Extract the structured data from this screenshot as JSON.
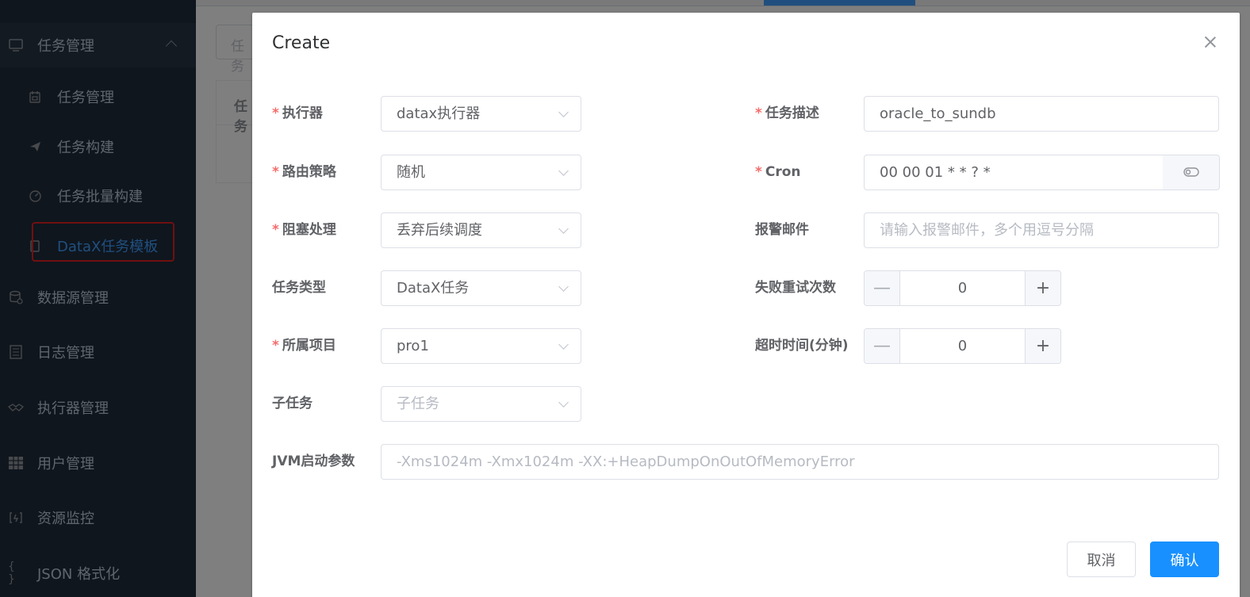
{
  "sidebar": {
    "group_label": "任务管理",
    "sub_items": [
      {
        "label": "任务管理",
        "icon": "calendar-icon"
      },
      {
        "label": "任务构建",
        "icon": "send-icon"
      },
      {
        "label": "任务批量构建",
        "icon": "dashboard-icon"
      },
      {
        "label": "DataX任务模板",
        "icon": "document-icon"
      }
    ],
    "items": [
      {
        "label": "数据源管理",
        "icon": "database-icon"
      },
      {
        "label": "日志管理",
        "icon": "log-icon"
      },
      {
        "label": "执行器管理",
        "icon": "handshake-icon"
      },
      {
        "label": "用户管理",
        "icon": "grid-icon"
      },
      {
        "label": "资源监控",
        "icon": "monitor-icon"
      },
      {
        "label": "JSON 格式化",
        "icon": "braces-icon"
      }
    ],
    "active_color": "#409eff",
    "highlight_color": "#e02020"
  },
  "background": {
    "search_placeholder": "任务",
    "table_header": "任务"
  },
  "dialog": {
    "title": "Create",
    "fields": {
      "executor": {
        "label": "执行器",
        "value": "datax执行器",
        "required": true
      },
      "route": {
        "label": "路由策略",
        "value": "随机",
        "required": true
      },
      "block": {
        "label": "阻塞处理",
        "value": "丢弃后续调度",
        "required": true
      },
      "job_type": {
        "label": "任务类型",
        "value": "DataX任务",
        "required": false
      },
      "project": {
        "label": "所属项目",
        "value": "pro1",
        "required": true
      },
      "child": {
        "label": "子任务",
        "placeholder": "子任务",
        "required": false
      },
      "jvm": {
        "label": "JVM启动参数",
        "placeholder": "-Xms1024m -Xmx1024m -XX:+HeapDumpOnOutOfMemoryError",
        "required": false
      },
      "desc": {
        "label": "任务描述",
        "value": "oracle_to_sundb",
        "required": true
      },
      "cron": {
        "label": "Cron",
        "value": "00 00 01 * * ? *",
        "required": true
      },
      "email": {
        "label": "报警邮件",
        "placeholder": "请输入报警邮件，多个用逗号分隔",
        "required": false
      },
      "retry": {
        "label": "失败重试次数",
        "value": "0",
        "required": false
      },
      "timeout": {
        "label": "超时时间(分钟)",
        "value": "0",
        "required": false
      }
    },
    "required_mark": "*",
    "cancel_label": "取消",
    "confirm_label": "确认",
    "primary_color": "#1890ff"
  }
}
